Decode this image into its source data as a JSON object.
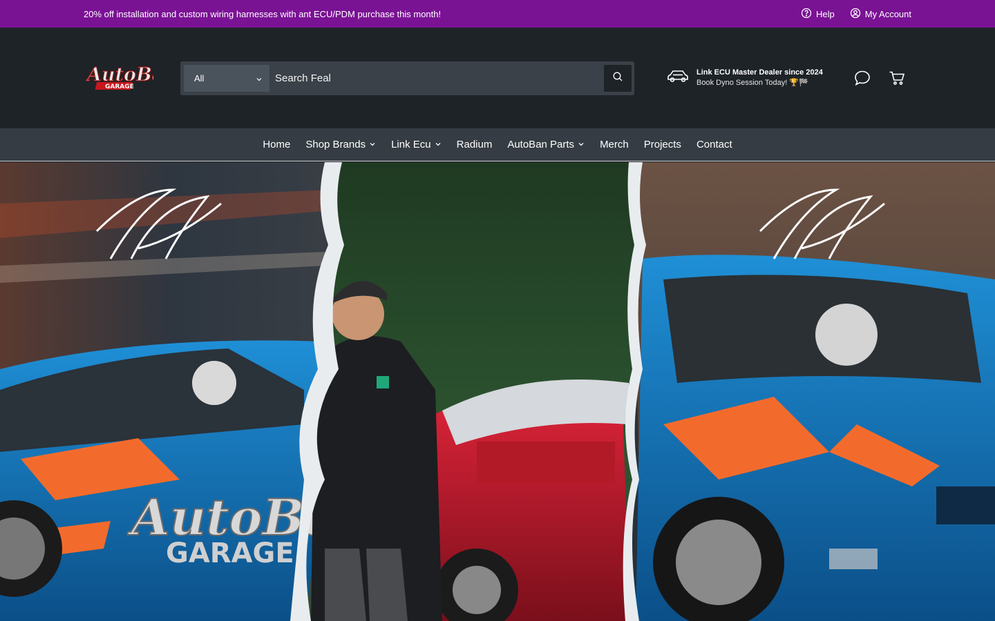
{
  "announcement": {
    "message": "20% off installation and custom wiring harnesses with ant ECU/PDM purchase this month!",
    "help_label": "Help",
    "account_label": "My Account",
    "bg_color": "#7a1294"
  },
  "header": {
    "logo_alt": "AutoBan Garage",
    "search": {
      "category": "All",
      "placeholder": "Search Feal"
    },
    "promo": {
      "title": "Link ECU Master Dealer since 2024",
      "subtitle": "Book Dyno Session Today! 🏆🏁"
    }
  },
  "nav": {
    "items": [
      {
        "label": "Home",
        "dropdown": false
      },
      {
        "label": "Shop Brands",
        "dropdown": true
      },
      {
        "label": "Link Ecu",
        "dropdown": true
      },
      {
        "label": "Radium",
        "dropdown": false
      },
      {
        "label": "AutoBan Parts",
        "dropdown": true
      },
      {
        "label": "Merch",
        "dropdown": false
      },
      {
        "label": "Projects",
        "dropdown": false
      },
      {
        "label": "Contact",
        "dropdown": false
      }
    ]
  },
  "hero": {
    "image_description": "collage of drift cars and a man in a hoodie"
  }
}
